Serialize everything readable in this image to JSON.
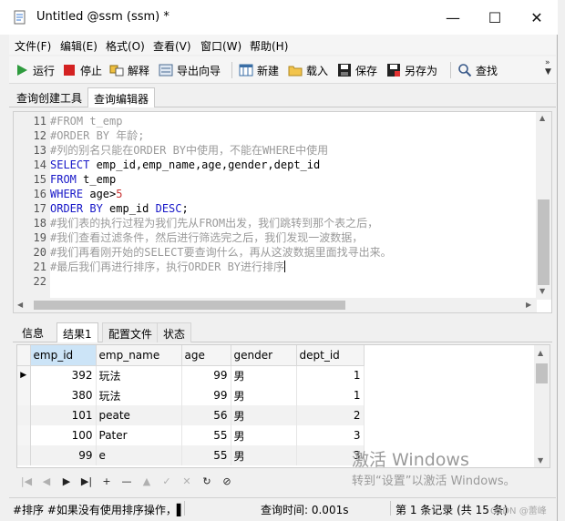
{
  "window": {
    "title": "Untitled @ssm (ssm) *",
    "buttons": {
      "minimize": "—",
      "maximize": "☐",
      "close": "✕"
    }
  },
  "menu": [
    "文件(F)",
    "编辑(E)",
    "格式(O)",
    "查看(V)",
    "窗口(W)",
    "帮助(H)"
  ],
  "toolbar": {
    "run": "运行",
    "stop": "停止",
    "explain": "解释",
    "export": "导出向导",
    "new": "新建",
    "load": "载入",
    "save": "保存",
    "save_as": "另存为",
    "find": "查找",
    "more": "»"
  },
  "top_tabs": [
    "查询创建工具",
    "查询编辑器"
  ],
  "editor": {
    "line_numbers": [
      "11",
      "12",
      "13",
      "14",
      "15",
      "16",
      "17",
      "18",
      "19",
      "20",
      "21",
      "22"
    ],
    "lines": {
      "l11": "#FROM t_emp",
      "l12": "#ORDER BY 年龄;",
      "l13": "#列的别名只能在ORDER BY中使用，不能在WHERE中使用",
      "l14_kw": "SELECT",
      "l14_rest": " emp_id,emp_name,age,gender,dept_id",
      "l15_kw": "FROM",
      "l15_rest": " t_emp",
      "l16_kw": "WHERE",
      "l16_rest": " age>",
      "l16_num": "5",
      "l17_kw1": "ORDER BY",
      "l17_mid": " emp_id ",
      "l17_kw2": "DESC",
      "l17_end": ";",
      "l18": "#我们表的执行过程为我们先从FROM出发，我们跳转到那个表之后，",
      "l19": "#我们查看过滤条件，然后进行筛选完之后，我们发现一波数据，",
      "l20": "#我们再看刚开始的SELECT要查询什么，再从这波数据里面找寻出来。",
      "l21": "#最后我们再进行排序，执行ORDER BY进行排序",
      "l22": ""
    }
  },
  "result_tabs": [
    "信息",
    "结果1",
    "配置文件",
    "状态"
  ],
  "grid": {
    "columns": [
      "emp_id",
      "emp_name",
      "age",
      "gender",
      "dept_id"
    ],
    "rows": [
      [
        "392",
        "玩法",
        "99",
        "男",
        "1"
      ],
      [
        "380",
        "玩法",
        "99",
        "男",
        "1"
      ],
      [
        "101",
        "peate",
        "56",
        "男",
        "2"
      ],
      [
        "100",
        "Pater",
        "55",
        "男",
        "3"
      ],
      [
        "99",
        "e",
        "55",
        "男",
        "3"
      ]
    ]
  },
  "nav_buttons": [
    "|◀",
    "◀",
    "▶",
    "▶|",
    "+",
    "—",
    "▲",
    "✓",
    "✕",
    "↻",
    "⊘"
  ],
  "watermark": {
    "line1": "激活 Windows",
    "line2": "转到“设置”以激活 Windows。"
  },
  "status": {
    "sql": "#排序 #如果没有使用排序操作，▌",
    "query_time": "查询时间: 0.001s",
    "records": "第 1 条记录 (共 15 条)",
    "credit": "CSDN @蕾峰"
  }
}
